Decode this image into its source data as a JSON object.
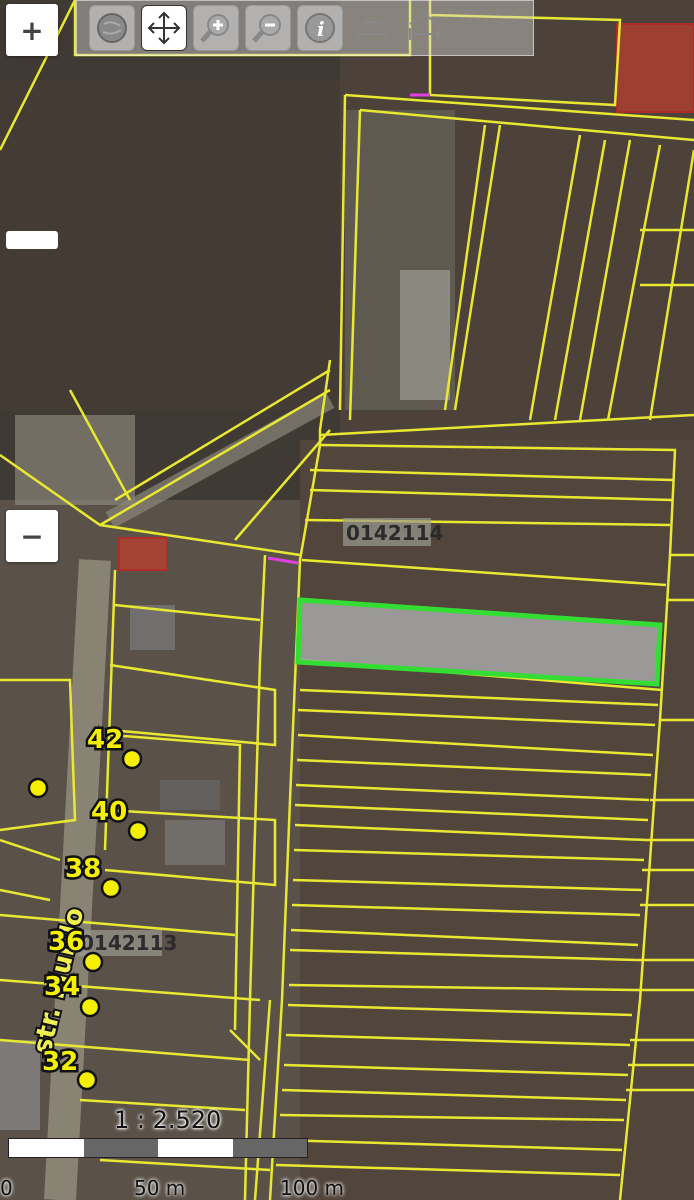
{
  "map": {
    "parcel_labels": [
      "0142114",
      "0142113"
    ],
    "house_numbers": [
      "42",
      "40",
      "38",
      "36",
      "34",
      "32"
    ],
    "street_label": "str. Murilo",
    "highlight_color": "#33dd33",
    "parcel_line_color": "#e8e832",
    "background_color": "#4a4038"
  },
  "zoom": {
    "in_label": "+",
    "out_label": "−"
  },
  "toolbar": {
    "tools": [
      "globe-icon",
      "pan-icon",
      "zoom-in-icon",
      "zoom-out-icon",
      "info-icon",
      "measure-length-icon",
      "measure-area-icon"
    ],
    "active_tool": "pan-icon"
  },
  "scale": {
    "ratio": "1 : 2.520",
    "labels": [
      "0",
      "50 m",
      "100 m"
    ]
  }
}
